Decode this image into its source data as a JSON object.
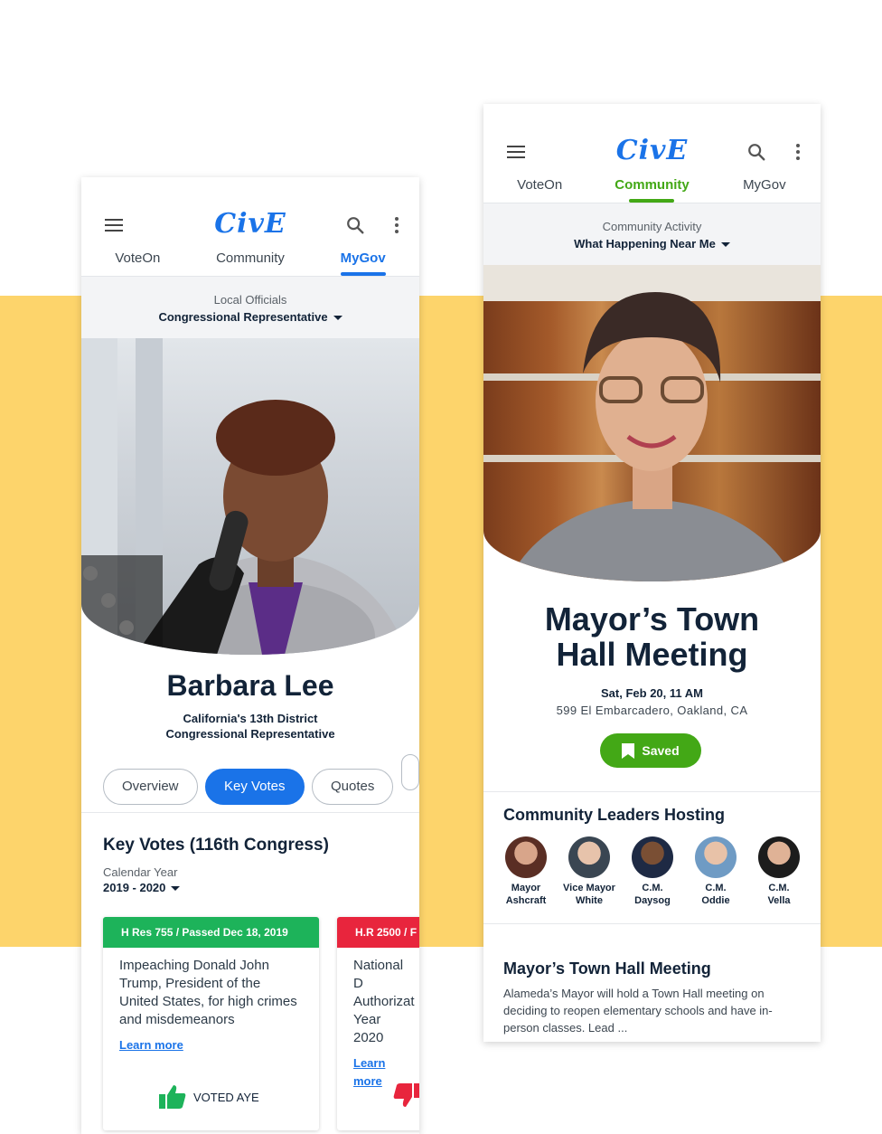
{
  "colors": {
    "primary_blue": "#1a73e8",
    "green": "#43a816",
    "vote_green": "#1db35a",
    "vote_red": "#e8253d",
    "background_yellow": "#fdd46b",
    "navy": "#122338"
  },
  "left": {
    "logo": "CivE",
    "tabs": [
      "VoteOn",
      "Community",
      "MyGov"
    ],
    "active_tab": "MyGov",
    "sub_caption": "Local Officials",
    "sub_select": "Congressional Representative",
    "name": "Barbara Lee",
    "district": "California's 13th District",
    "role": "Congressional Representative",
    "pills": [
      "Overview",
      "Key Votes",
      "Quotes"
    ],
    "active_pill": "Key Votes",
    "section_title": "Key Votes (116th Congress)",
    "calendar_label": "Calendar Year",
    "calendar_value": "2019 - 2020",
    "votes": [
      {
        "header": "H Res 755 / Passed Dec 18, 2019",
        "text": "Impeaching Donald John Trump, President of the United States, for high crimes and misdemeanors",
        "learn": "Learn more",
        "result": "VOTED AYE",
        "color": "#1db35a",
        "icon": "thumbs-up-icon"
      },
      {
        "header": "H.R 2500 / F",
        "text": "National D Authorizat Year 2020",
        "learn": "Learn more",
        "result": "",
        "color": "#e8253d",
        "icon": "thumbs-down-icon"
      }
    ]
  },
  "right": {
    "logo": "CivE",
    "tabs": [
      "VoteOn",
      "Community",
      "MyGov"
    ],
    "active_tab": "Community",
    "sub_caption": "Community Activity",
    "sub_select": "What Happening Near Me",
    "event_title_line1": "Mayor’s Town",
    "event_title_line2": "Hall Meeting",
    "event_date": "Sat, Feb 20, 11 AM",
    "event_address": "599 El Embarcadero, Oakland, CA",
    "saved_label": "Saved",
    "leaders_title": "Community Leaders Hosting",
    "leaders": [
      {
        "line1": "Mayor",
        "line2": "Ashcraft"
      },
      {
        "line1": "Vice Mayor",
        "line2": "White"
      },
      {
        "line1": "C.M.",
        "line2": "Daysog"
      },
      {
        "line1": "C.M.",
        "line2": "Oddie"
      },
      {
        "line1": "C.M.",
        "line2": "Vella"
      }
    ],
    "post_title": "Mayor’s Town Hall Meeting",
    "post_text": "Alameda’s Mayor will hold a Town Hall meeting on deciding to reopen elementary schools and have in-person classes. Lead ..."
  }
}
